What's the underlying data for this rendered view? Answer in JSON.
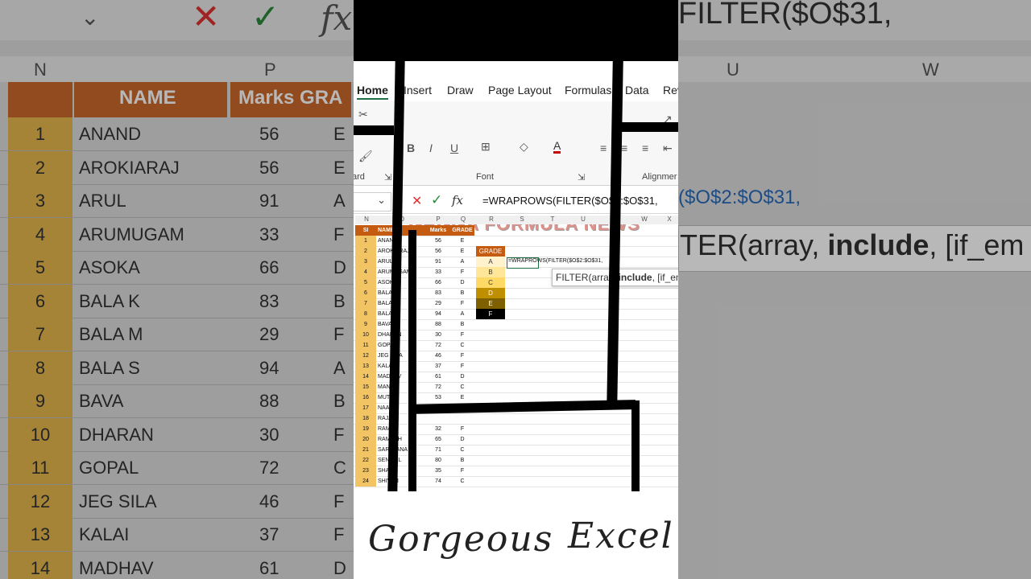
{
  "ribbon": {
    "tabs": [
      "Home",
      "Insert",
      "Draw",
      "Page Layout",
      "Formulas",
      "Data",
      "Rev"
    ],
    "active_tab": "Home",
    "font_group": "Font",
    "clipboard_group": "ard",
    "alignment_group": "Alignmer",
    "bold": "B",
    "italic": "I",
    "underline": "U"
  },
  "watermark": "GBGGA FORMULA NEWS",
  "formula_bar": {
    "cancel": "✕",
    "enter": "✓",
    "fx": "fx",
    "formula": "=WRAPROWS(FILTER($O$2:$O$31,",
    "formula_short": "=WRAPROWS(FILTER($O$",
    "formula_tail": "$O$31,"
  },
  "columns": [
    "N",
    "O",
    "P",
    "Q",
    "R",
    "S",
    "T",
    "U",
    "V",
    "W",
    "X"
  ],
  "table": {
    "headers": [
      "SI",
      "NAME",
      "Marks",
      "GRADE"
    ],
    "rows": [
      [
        "1",
        "ANAND",
        "56",
        "E"
      ],
      [
        "2",
        "AROKIARAJ",
        "56",
        "E"
      ],
      [
        "3",
        "ARUL",
        "91",
        "A"
      ],
      [
        "4",
        "ARUMUGAM",
        "33",
        "F"
      ],
      [
        "5",
        "ASOKAN",
        "66",
        "D"
      ],
      [
        "6",
        "BALA K",
        "83",
        "B"
      ],
      [
        "7",
        "BALA M",
        "29",
        "F"
      ],
      [
        "8",
        "BALA S",
        "94",
        "A"
      ],
      [
        "9",
        "BAVA",
        "88",
        "B"
      ],
      [
        "10",
        "DHARAN",
        "30",
        "F"
      ],
      [
        "11",
        "GOPAL",
        "72",
        "C"
      ],
      [
        "12",
        "JEG SILA",
        "46",
        "F"
      ],
      [
        "13",
        "KALAI",
        "37",
        "F"
      ],
      [
        "14",
        "MADHAV",
        "61",
        "D"
      ],
      [
        "15",
        "MANI",
        "72",
        "C"
      ],
      [
        "16",
        "MUTHU",
        "53",
        "E"
      ],
      [
        "17",
        "NAAN",
        "66",
        "D"
      ],
      [
        "18",
        "RAJA",
        "",
        ""
      ],
      [
        "19",
        "RAMAN",
        "32",
        "F"
      ],
      [
        "20",
        "RAMESH",
        "65",
        "D"
      ],
      [
        "21",
        "SARAVANA",
        "71",
        "C"
      ],
      [
        "22",
        "SENTHIL",
        "80",
        "B"
      ],
      [
        "23",
        "SHAN",
        "35",
        "F"
      ],
      [
        "24",
        "SHIVAJI",
        "74",
        "C"
      ]
    ]
  },
  "grade_list": {
    "header": "GRADE",
    "items": [
      "A",
      "B",
      "C",
      "D",
      "E",
      "F"
    ],
    "colors": [
      "#fff2cc",
      "#ffe699",
      "#ffd966",
      "#bf8f00",
      "#7f6000",
      "#000000"
    ]
  },
  "cell_edit": "=WRAPROWS(FILTER($O$2:$O$31,",
  "tooltip": {
    "pre": "FILTER(array, ",
    "bold": "include",
    "post": ", [if_em"
  },
  "footer": {
    "left": "Gorgeous",
    "right": "Excel"
  },
  "background": {
    "left_header": {
      "name": "NAME",
      "marks": "Marks",
      "grade": "GRA",
      "col_n": "N",
      "col_p": "P"
    },
    "left_rows": [
      [
        "1",
        "ANAND",
        "56",
        "E"
      ],
      [
        "2",
        "AROKIARAJ",
        "56",
        "E"
      ],
      [
        "3",
        "ARUL",
        "91",
        "A"
      ],
      [
        "4",
        "ARUMUGAM",
        "33",
        "F"
      ],
      [
        "5",
        "ASOKA",
        "66",
        "D"
      ],
      [
        "6",
        "BALA K",
        "83",
        "B"
      ],
      [
        "7",
        "BALA M",
        "29",
        "F"
      ],
      [
        "8",
        "BALA S",
        "94",
        "A"
      ],
      [
        "9",
        "BAVA",
        "88",
        "B"
      ],
      [
        "10",
        "DHARAN",
        "30",
        "F"
      ],
      [
        "11",
        "GOPAL",
        "72",
        "C"
      ],
      [
        "12",
        "JEG SILA",
        "46",
        "F"
      ],
      [
        "13",
        "KALAI",
        "37",
        "F"
      ],
      [
        "14",
        "MADHAV",
        "61",
        "D"
      ]
    ],
    "right_formula": "FILTER($O$31,",
    "right_cols": [
      "U",
      "W"
    ],
    "right_ref": "($O$2:$O$31,",
    "right_tip_pre": "TER(array, ",
    "right_tip_bold": "include",
    "right_tip_post": ", [if_em"
  }
}
